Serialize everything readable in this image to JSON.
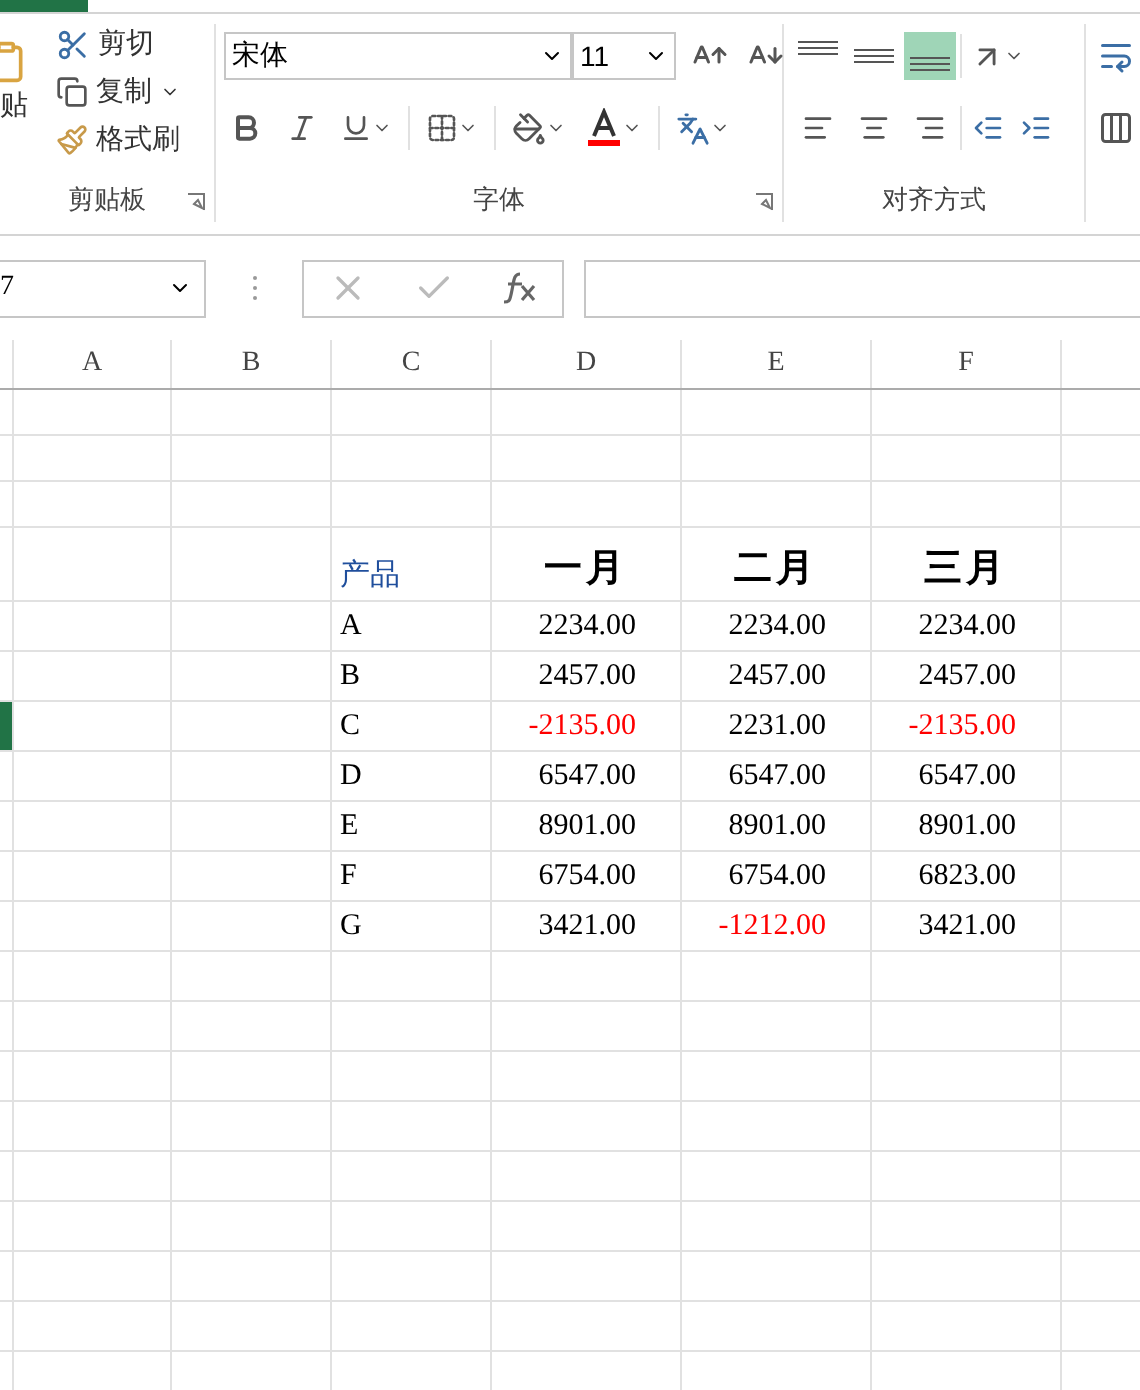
{
  "ribbon": {
    "clipboard": {
      "paste_label": "贴",
      "cut": "剪切",
      "copy": "复制",
      "format_painter": "格式刷",
      "group_label": "剪贴板"
    },
    "font": {
      "name": "宋体",
      "size": "11",
      "group_label": "字体"
    },
    "alignment": {
      "vertical": [
        {
          "selected": false
        },
        {
          "selected": false
        },
        {
          "selected": true
        }
      ],
      "group_label": "对齐方式"
    }
  },
  "formula_bar": {
    "name_box": "7"
  },
  "sheet": {
    "columns": [
      "A",
      "B",
      "C",
      "D",
      "E",
      "F"
    ],
    "header_row": {
      "label": "产品",
      "months": [
        "一月",
        "二月",
        "三月"
      ]
    },
    "rows": [
      {
        "product": "A",
        "values": [
          {
            "text": "2234.00",
            "negative": false
          },
          {
            "text": "2234.00",
            "negative": false
          },
          {
            "text": "2234.00",
            "negative": false
          }
        ]
      },
      {
        "product": "B",
        "values": [
          {
            "text": "2457.00",
            "negative": false
          },
          {
            "text": "2457.00",
            "negative": false
          },
          {
            "text": "2457.00",
            "negative": false
          }
        ]
      },
      {
        "product": "C",
        "values": [
          {
            "text": "-2135.00",
            "negative": true
          },
          {
            "text": "2231.00",
            "negative": false
          },
          {
            "text": "-2135.00",
            "negative": true
          }
        ]
      },
      {
        "product": "D",
        "values": [
          {
            "text": "6547.00",
            "negative": false
          },
          {
            "text": "6547.00",
            "negative": false
          },
          {
            "text": "6547.00",
            "negative": false
          }
        ]
      },
      {
        "product": "E",
        "values": [
          {
            "text": "8901.00",
            "negative": false
          },
          {
            "text": "8901.00",
            "negative": false
          },
          {
            "text": "8901.00",
            "negative": false
          }
        ]
      },
      {
        "product": "F",
        "values": [
          {
            "text": "6754.00",
            "negative": false
          },
          {
            "text": "6754.00",
            "negative": false
          },
          {
            "text": "6823.00",
            "negative": false
          }
        ]
      },
      {
        "product": "G",
        "values": [
          {
            "text": "3421.00",
            "negative": false
          },
          {
            "text": "-1212.00",
            "negative": true
          },
          {
            "text": "3421.00",
            "negative": false
          }
        ]
      }
    ]
  }
}
